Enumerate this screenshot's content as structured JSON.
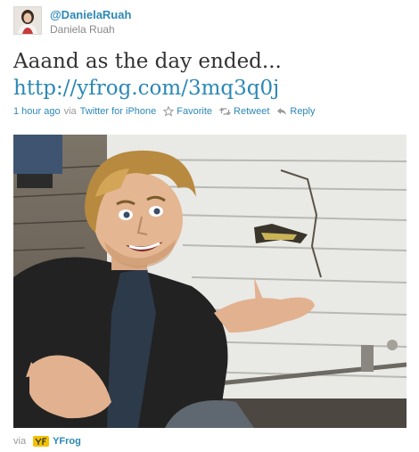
{
  "user": {
    "handle": "@DanielaRuah",
    "name": "Daniela Ruah"
  },
  "tweet": {
    "text": "Aaand as the day ended...",
    "link": "http://yfrog.com/3mq3q0j"
  },
  "meta": {
    "time": "1 hour ago",
    "via_word": "via",
    "client": "Twitter for iPhone"
  },
  "actions": {
    "favorite": "Favorite",
    "retweet": "Retweet",
    "reply": "Reply"
  },
  "footer": {
    "via_word": "via",
    "source": "YFrog"
  },
  "colors": {
    "link": "#2c88b6",
    "meta_text": "#999999",
    "tweet_text": "#333333"
  }
}
